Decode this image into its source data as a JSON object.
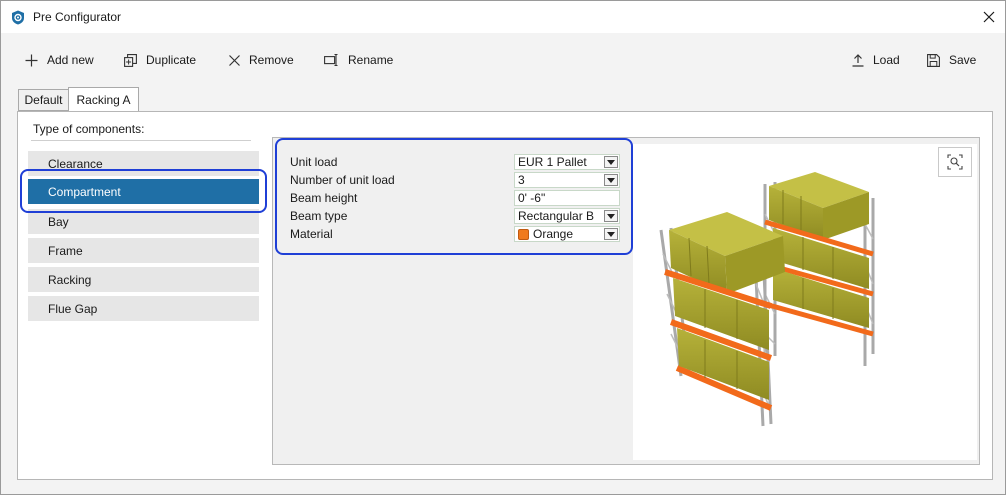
{
  "window": {
    "title": "Pre Configurator"
  },
  "toolbar": {
    "add_new": "Add new",
    "duplicate": "Duplicate",
    "remove": "Remove",
    "rename": "Rename",
    "load": "Load",
    "save": "Save"
  },
  "tabs": [
    {
      "label": "Default",
      "active": false
    },
    {
      "label": "Racking A",
      "active": true
    }
  ],
  "components": {
    "heading": "Type of components:",
    "items": [
      {
        "label": "Clearance",
        "selected": false
      },
      {
        "label": "Compartment",
        "selected": true
      },
      {
        "label": "Bay",
        "selected": false
      },
      {
        "label": "Frame",
        "selected": false
      },
      {
        "label": "Racking",
        "selected": false
      },
      {
        "label": "Flue Gap",
        "selected": false
      }
    ]
  },
  "properties": [
    {
      "label": "Unit load",
      "value": "EUR 1 Pallet",
      "type": "dropdown"
    },
    {
      "label": "Number of unit load",
      "value": "3",
      "type": "dropdown"
    },
    {
      "label": "Beam height",
      "value": "0' -6\"",
      "type": "text"
    },
    {
      "label": "Beam type",
      "value": "Rectangular B",
      "type": "dropdown"
    },
    {
      "label": "Material",
      "value": "Orange",
      "type": "dropdown",
      "swatch_color": "#f07a1c"
    }
  ],
  "colors": {
    "selection": "#1f6fa6",
    "highlight_outline": "#1f3fd6",
    "beam": "#f26a1b",
    "load": "#a7a32a",
    "frame": "#b8b8b8"
  },
  "icons": {
    "app": "shield-icon",
    "close": "close-icon",
    "add": "plus-icon",
    "duplicate": "duplicate-icon",
    "remove": "x-icon",
    "rename": "rename-icon",
    "load": "upload-icon",
    "save": "save-icon",
    "zoom": "zoom-fit-icon"
  }
}
